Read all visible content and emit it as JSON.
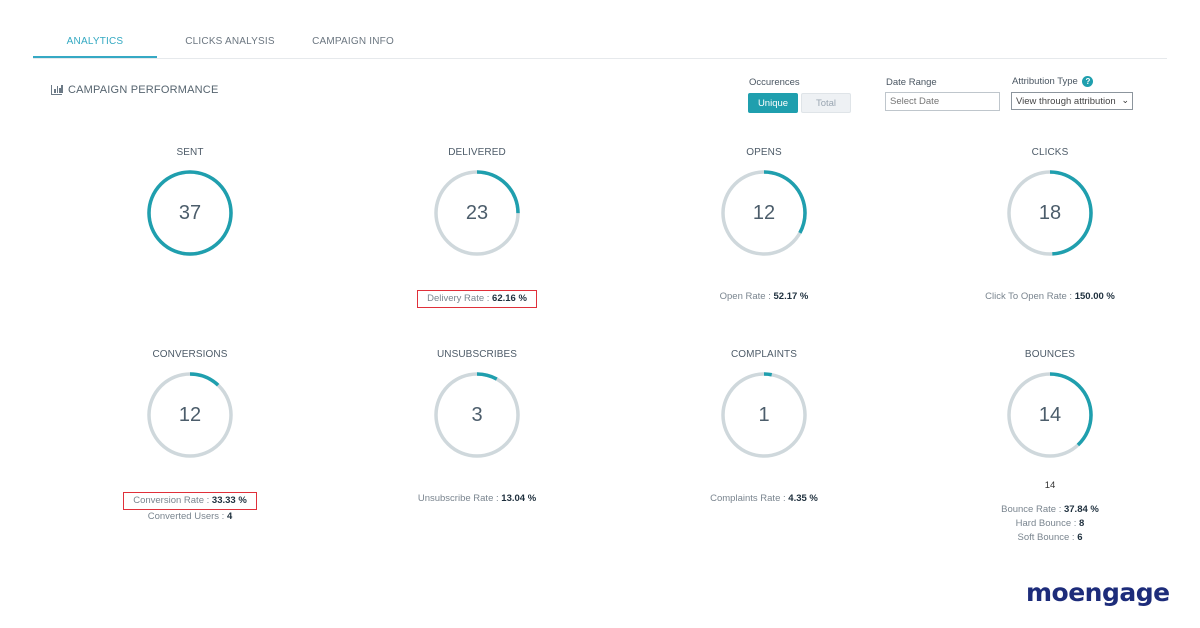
{
  "tabs": [
    {
      "label": "ANALYTICS",
      "active": true
    },
    {
      "label": "CLICKS ANALYSIS",
      "active": false
    },
    {
      "label": "CAMPAIGN INFO",
      "active": false
    }
  ],
  "section": {
    "title": "CAMPAIGN PERFORMANCE",
    "icon": "bar-chart-icon"
  },
  "controls": {
    "occurences_label": "Occurences",
    "unique_label": "Unique",
    "total_label": "Total",
    "date_range_label": "Date Range",
    "date_placeholder": "Select Date",
    "attribution_label": "Attribution Type",
    "attribution_value": "View through attribution",
    "help_icon": "?"
  },
  "colors": {
    "accent": "#1f9fae",
    "ring_track": "#cfd8dc",
    "highlight": "#e0303a",
    "brand": "#1d2c7a"
  },
  "metrics": [
    {
      "title": "SENT",
      "value": "37",
      "fill": 1.0,
      "lines": []
    },
    {
      "title": "DELIVERED",
      "value": "23",
      "fill": 0.25,
      "highlight": true,
      "lines": [
        {
          "label": "Delivery Rate : ",
          "value": "62.16 %"
        }
      ]
    },
    {
      "title": "OPENS",
      "value": "12",
      "fill": 0.33,
      "lines": [
        {
          "label": "Open Rate : ",
          "value": "52.17 %"
        }
      ]
    },
    {
      "title": "CLICKS",
      "value": "18",
      "fill": 0.49,
      "lines": [
        {
          "label": "Click To Open Rate : ",
          "value": "150.00 %"
        }
      ]
    },
    {
      "title": "CONVERSIONS",
      "value": "12",
      "fill": 0.12,
      "highlight": true,
      "lines": [
        {
          "label": "Conversion Rate : ",
          "value": "33.33 %"
        },
        {
          "label": "Converted Users : ",
          "value": "4"
        }
      ]
    },
    {
      "title": "UNSUBSCRIBES",
      "value": "3",
      "fill": 0.08,
      "lines": [
        {
          "label": "Unsubscribe Rate : ",
          "value": "13.04 %"
        }
      ]
    },
    {
      "title": "COMPLAINTS",
      "value": "1",
      "fill": 0.03,
      "lines": [
        {
          "label": "Complaints Rate : ",
          "value": "4.35 %"
        }
      ]
    },
    {
      "title": "BOUNCES",
      "value": "14",
      "fill": 0.38,
      "extra": "14",
      "lines": [
        {
          "label": "Bounce Rate : ",
          "value": "37.84 %"
        },
        {
          "label": "Hard Bounce : ",
          "value": "8"
        },
        {
          "label": "Soft Bounce : ",
          "value": "6"
        }
      ]
    }
  ],
  "logo": {
    "text": "moengage"
  }
}
